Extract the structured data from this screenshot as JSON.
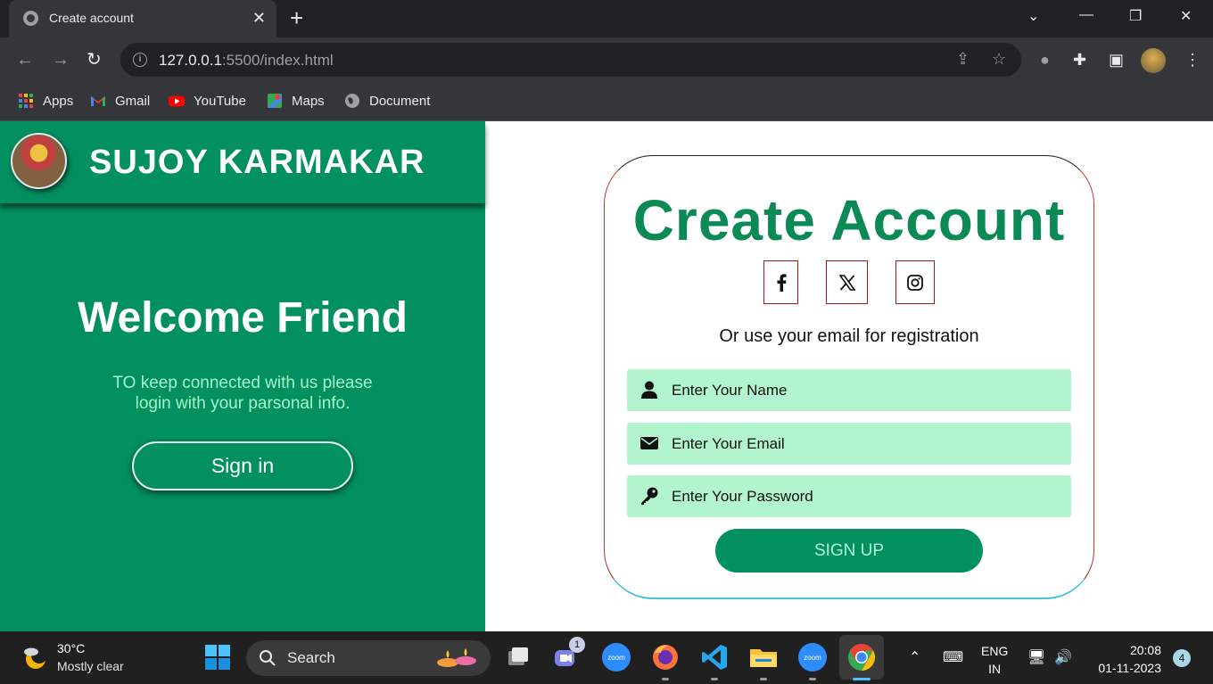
{
  "browser": {
    "tab_title": "Create account",
    "url_host": "127.0.0.1",
    "url_rest": ":5500/index.html",
    "bookmarks": [
      {
        "label": "Apps",
        "icon": "apps-grid-icon"
      },
      {
        "label": "Gmail",
        "icon": "gmail-icon"
      },
      {
        "label": "YouTube",
        "icon": "youtube-icon"
      },
      {
        "label": "Maps",
        "icon": "maps-icon"
      },
      {
        "label": "Document",
        "icon": "globe-icon"
      }
    ]
  },
  "left_panel": {
    "brand_name": "SUJOY KARMAKAR",
    "welcome_title": "Welcome Friend",
    "welcome_line1": "TO keep connected with us please",
    "welcome_line2": "login with your parsonal info.",
    "signin_label": "Sign in"
  },
  "form": {
    "title": "Create Account",
    "social": [
      "facebook-icon",
      "x-icon",
      "instagram-icon"
    ],
    "or_text": "Or use your email for registration",
    "name_placeholder": "Enter Your Name",
    "email_placeholder": "Enter Your Email",
    "password_placeholder": "Enter Your Password",
    "signup_label": "SIGN UP"
  },
  "taskbar": {
    "temperature": "30°C",
    "condition": "Mostly clear",
    "search_label": "Search",
    "teams_badge": "1",
    "lang_line1": "ENG",
    "lang_line2": "IN",
    "time": "20:08",
    "date": "01-11-2023",
    "notification_count": "4"
  },
  "colors": {
    "brand_green": "#029061",
    "title_green": "#0b8a56",
    "input_bg": "#b1f4cd",
    "subtitle_text": "#a6f5c8"
  }
}
